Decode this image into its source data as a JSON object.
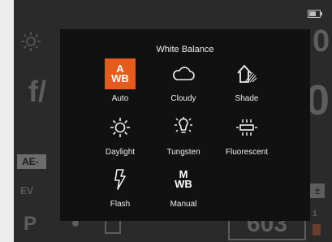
{
  "status": {
    "battery_icon": "battery-icon"
  },
  "background": {
    "shutter_text": "f/",
    "top_right_digit": "0",
    "mid_right_digit": "0",
    "ae_label": "AE-",
    "ev_label": "EV",
    "mode": "P",
    "shots_remaining": "603",
    "frame_count": "1"
  },
  "modal": {
    "title": "White Balance",
    "options": [
      {
        "label": "Auto",
        "icon_top": "A",
        "icon_bottom": "WB",
        "selected": true
      },
      {
        "label": "Cloudy",
        "icon": "cloud-icon"
      },
      {
        "label": "Shade",
        "icon": "shade-house-icon"
      },
      {
        "label": "Daylight",
        "icon": "sun-icon"
      },
      {
        "label": "Tungsten",
        "icon": "bulb-icon"
      },
      {
        "label": "Fluorescent",
        "icon": "fluorescent-icon"
      },
      {
        "label": "Flash",
        "icon": "flash-icon"
      },
      {
        "label": "Manual",
        "icon_top": "M",
        "icon_bottom": "WB"
      }
    ]
  },
  "colors": {
    "accent": "#e55b1b",
    "modal_bg": "#111111",
    "screen_bg": "#2a2a2a"
  }
}
